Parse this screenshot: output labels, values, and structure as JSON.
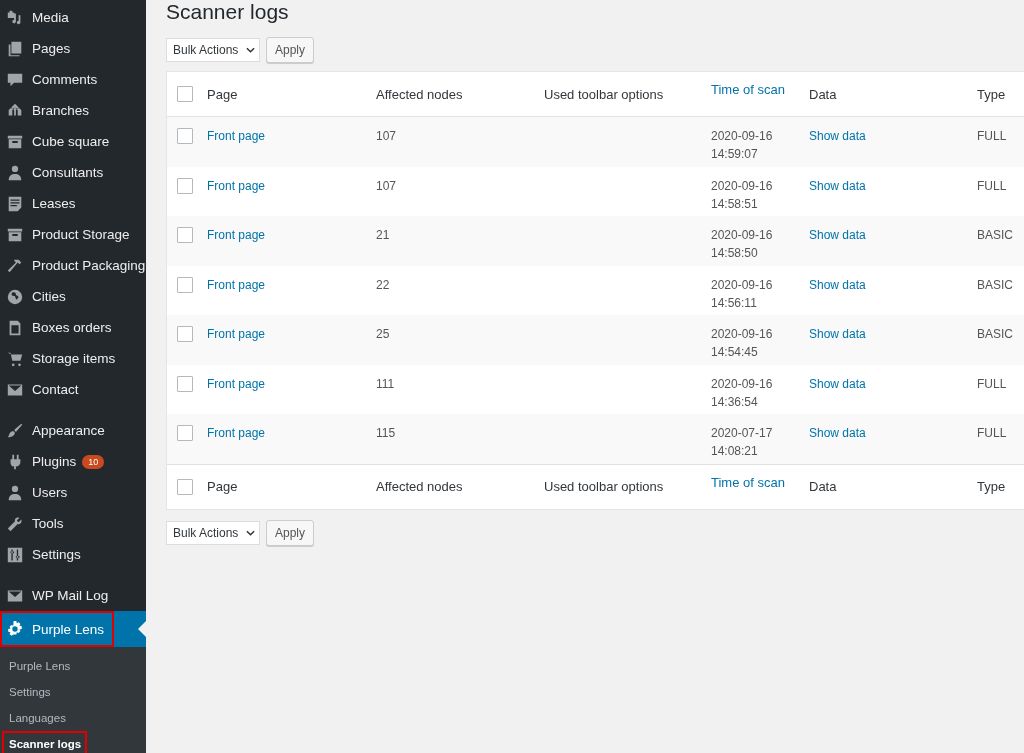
{
  "sidebar": {
    "menu_groups": [
      [
        {
          "label": "Media",
          "current": false,
          "highlighted": false
        },
        {
          "label": "Pages",
          "current": false,
          "highlighted": false
        },
        {
          "label": "Comments",
          "current": false,
          "highlighted": false
        },
        {
          "label": "Branches",
          "current": false,
          "highlighted": false
        },
        {
          "label": "Cube square",
          "current": false,
          "highlighted": false
        },
        {
          "label": "Consultants",
          "current": false,
          "highlighted": false
        },
        {
          "label": "Leases",
          "current": false,
          "highlighted": false
        },
        {
          "label": "Product Storage",
          "current": false,
          "highlighted": false
        },
        {
          "label": "Product Packaging",
          "current": false,
          "highlighted": false
        },
        {
          "label": "Cities",
          "current": false,
          "highlighted": false
        },
        {
          "label": "Boxes orders",
          "current": false,
          "highlighted": false
        },
        {
          "label": "Storage items",
          "current": false,
          "highlighted": false
        },
        {
          "label": "Contact",
          "current": false,
          "highlighted": false
        }
      ],
      [
        {
          "label": "Appearance",
          "current": false,
          "highlighted": false
        },
        {
          "label": "Plugins",
          "badge": "10",
          "current": false,
          "highlighted": false
        },
        {
          "label": "Users",
          "current": false,
          "highlighted": false
        },
        {
          "label": "Tools",
          "current": false,
          "highlighted": false
        },
        {
          "label": "Settings",
          "current": false,
          "highlighted": false
        }
      ],
      [
        {
          "label": "WP Mail Log",
          "current": false,
          "highlighted": false
        },
        {
          "label": "Purple Lens",
          "current": true,
          "highlighted": true,
          "submenu": [
            {
              "label": "Purple Lens",
              "selected": false,
              "highlighted": false
            },
            {
              "label": "Settings",
              "selected": false,
              "highlighted": false
            },
            {
              "label": "Languages",
              "selected": false,
              "highlighted": false
            },
            {
              "label": "Scanner logs",
              "selected": true,
              "highlighted": true
            }
          ]
        }
      ]
    ]
  },
  "page_title": "Scanner logs",
  "top_toolbar": {
    "bulk_actions": "Bulk Actions",
    "apply": "Apply"
  },
  "table": {
    "select_all_checked": false,
    "footer_select_all_checked": false,
    "columns": [
      {
        "label": "Page",
        "sortable": false
      },
      {
        "label": "Affected nodes",
        "sortable": false
      },
      {
        "label": "Used toolbar options",
        "sortable": false
      },
      {
        "label": "Time of scan",
        "sortable": true
      },
      {
        "label": "Data",
        "sortable": false
      },
      {
        "label": "Type",
        "sortable": false
      }
    ],
    "rows": [
      {
        "checked": false,
        "page": "Front page",
        "affected_nodes": "107",
        "time_of_scan": "2020-09-16 14:59:07",
        "data": "Show data",
        "type": "FULL"
      },
      {
        "checked": false,
        "page": "Front page",
        "affected_nodes": "107",
        "time_of_scan": "2020-09-16 14:58:51",
        "data": "Show data",
        "type": "FULL"
      },
      {
        "checked": false,
        "page": "Front page",
        "affected_nodes": "21",
        "time_of_scan": "2020-09-16 14:58:50",
        "data": "Show data",
        "type": "BASIC"
      },
      {
        "checked": false,
        "page": "Front page",
        "affected_nodes": "22",
        "time_of_scan": "2020-09-16 14:56:11",
        "data": "Show data",
        "type": "BASIC"
      },
      {
        "checked": false,
        "page": "Front page",
        "affected_nodes": "25",
        "time_of_scan": "2020-09-16 14:54:45",
        "data": "Show data",
        "type": "BASIC"
      },
      {
        "checked": false,
        "page": "Front page",
        "affected_nodes": "111",
        "time_of_scan": "2020-09-16 14:36:54",
        "data": "Show data",
        "type": "FULL"
      },
      {
        "checked": false,
        "page": "Front page",
        "affected_nodes": "115",
        "time_of_scan": "2020-07-17 14:08:21",
        "data": "Show data",
        "type": "FULL"
      }
    ],
    "footer_columns": [
      {
        "label": "Page",
        "sortable": false
      },
      {
        "label": "Affected nodes",
        "sortable": false
      },
      {
        "label": "Used toolbar options",
        "sortable": false
      },
      {
        "label": "Time of scan",
        "sortable": true
      },
      {
        "label": "Data",
        "sortable": false
      },
      {
        "label": "Type",
        "sortable": false
      }
    ]
  },
  "bottom_toolbar": {
    "bulk_actions": "Bulk Actions",
    "apply": "Apply"
  }
}
